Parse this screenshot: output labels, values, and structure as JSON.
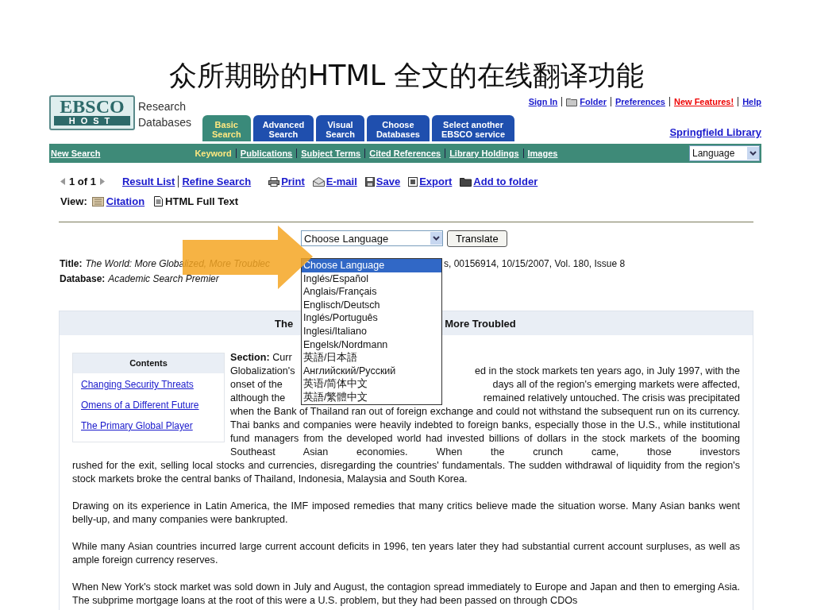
{
  "slide_title": "众所期盼的HTML 全文的在线翻译功能",
  "header": {
    "logo_top": "EBSCO",
    "logo_bottom": "HOST",
    "brand_lines": [
      "Research",
      "Databases"
    ],
    "top_links": [
      {
        "label": "Sign In",
        "kind": "link"
      },
      {
        "label": "Folder",
        "kind": "folder"
      },
      {
        "label": "Preferences",
        "kind": "link"
      },
      {
        "label": "New Features!",
        "kind": "highlight"
      },
      {
        "label": "Help",
        "kind": "link"
      }
    ],
    "library": "Springfield Library"
  },
  "tabs": [
    {
      "lines": [
        "Basic",
        "Search"
      ],
      "selected": true
    },
    {
      "lines": [
        "Advanced",
        "Search"
      ],
      "selected": false
    },
    {
      "lines": [
        "Visual",
        "Search"
      ],
      "selected": false
    },
    {
      "lines": [
        "Choose",
        "Databases"
      ],
      "selected": false
    },
    {
      "lines": [
        "Select another",
        "EBSCO service"
      ],
      "selected": false
    }
  ],
  "nav": {
    "new_search": "New Search",
    "items": [
      {
        "label": "Keyword",
        "selected": true
      },
      {
        "label": "Publications",
        "selected": false
      },
      {
        "label": "Subject Terms",
        "selected": false
      },
      {
        "label": "Cited References",
        "selected": false
      },
      {
        "label": "Library Holdings",
        "selected": false
      },
      {
        "label": "Images",
        "selected": false
      }
    ],
    "language": "Language"
  },
  "toolbar": {
    "pager": "1 of 1",
    "links": [
      "Result List",
      "Refine Search"
    ],
    "actions": [
      {
        "label": "Print",
        "kind": "print"
      },
      {
        "label": "E-mail",
        "kind": "email"
      },
      {
        "label": "Save",
        "kind": "save"
      },
      {
        "label": "Export",
        "kind": "export"
      },
      {
        "label": "Add to folder",
        "kind": "folder"
      }
    ]
  },
  "view": {
    "label": "View:",
    "items": [
      {
        "label": "Citation",
        "selected": false
      },
      {
        "label": "HTML Full Text",
        "selected": true
      }
    ]
  },
  "translate": {
    "select": "Choose Language",
    "button": "Translate",
    "expanded": true,
    "options": [
      {
        "label": "Choose Language",
        "selected": true
      },
      {
        "label": "Inglés/Español",
        "selected": false
      },
      {
        "label": "Anglais/Français",
        "selected": false
      },
      {
        "label": "Englisch/Deutsch",
        "selected": false
      },
      {
        "label": "Inglés/Português",
        "selected": false
      },
      {
        "label": "Inglesi/Italiano",
        "selected": false
      },
      {
        "label": "Engelsk/Nordmann",
        "selected": false
      },
      {
        "label": "英語/日本語",
        "selected": false
      },
      {
        "label": "Английский/Русский",
        "selected": false
      },
      {
        "label": "英语/简体中文",
        "selected": false
      },
      {
        "label": "英語/繁體中文",
        "selected": false
      }
    ]
  },
  "record": {
    "title_label": "Title:",
    "title_left": "The World: More Globalized, More Troublec",
    "title_right": "s, 00156914, 10/15/2007, Vol. 180, Issue 8",
    "database_label": "Database:",
    "database": "Academic Search Premier"
  },
  "article": {
    "heading_left": "The",
    "heading_right": "More Troubled",
    "contents_title": "Contents",
    "contents": [
      "Changing Security Threats",
      "Omens of a Different Future",
      "The Primary Global Player"
    ],
    "section_label": "Section:",
    "section_value": "Curr",
    "covered_lines": [
      {
        "left": "Globalization's",
        "right": "ed in the stock markets ten years ago, in July 1997, with the"
      },
      {
        "left": "onset of the",
        "right": "days all of the region's emerging markets were affected,"
      },
      {
        "left": "although the",
        "right": "remained relatively untouched. The crisis was precipitated"
      }
    ],
    "side_text": "when the Bank of Thailand ran out of foreign exchange and could not withstand the subsequent run on its currency. Thai banks and companies were heavily indebted to foreign banks, especially those in the U.S., while institutional fund managers from the developed world had invested billions of dollars in the stock markets of the booming Southeast Asian economies. When the crunch came, those investors",
    "paragraphs": [
      "rushed for the exit, selling local stocks and currencies, disregarding the countries' fundamentals. The sudden withdrawal of liquidity from the region's stock markets broke the central banks of Thailand, Indonesia, Malaysia and South Korea.",
      "Drawing on its experience in Latin America, the IMF imposed remedies that many critics believe made the situation worse. Many Asian banks went belly-up, and many companies were bankrupted.",
      "While many Asian countries incurred large current account deficits in 1996, ten years later they had substantial current account surpluses, as well as ample foreign currency reserves.",
      "When New York's stock market was sold down in July and August, the contagion spread immediately to Europe and Japan and then to emerging Asia. The subprime mortgage loans at the root of this were a U.S. problem, but they had been passed on through CDOs"
    ]
  }
}
